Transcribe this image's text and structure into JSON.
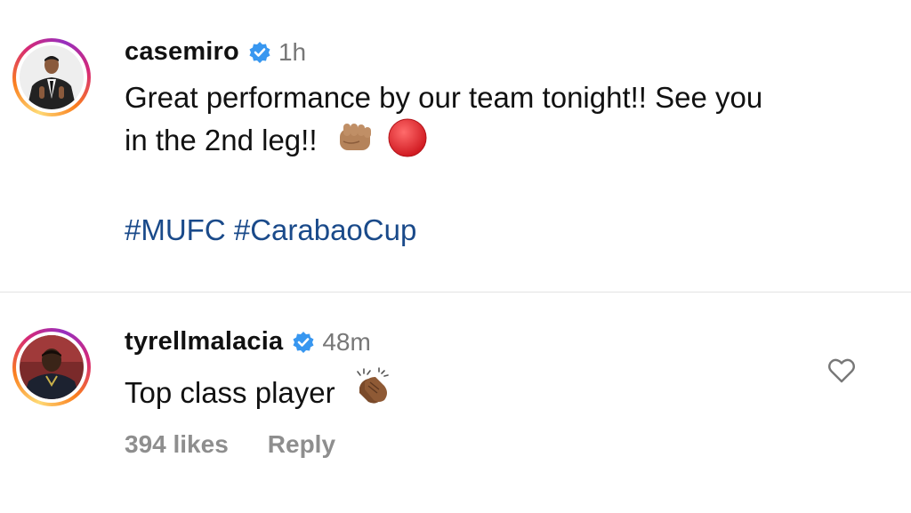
{
  "post": {
    "username": "casemiro",
    "time": "1h",
    "caption_line1": "Great performance by our team tonight!! See you",
    "caption_line2": "in the 2nd leg!!",
    "hashtags": [
      "#MUFC",
      "#CarabaoCup"
    ]
  },
  "comment": {
    "username": "tyrellmalacia",
    "time": "48m",
    "text": "Top class player",
    "likes": "394 likes",
    "reply_label": "Reply"
  },
  "icons": {
    "verified": "verified-badge-icon",
    "fist": "oncoming-fist-emoji",
    "red_circle": "red-circle-emoji",
    "clap": "clapping-hands-emoji",
    "like": "heart-outline-icon"
  },
  "colors": {
    "verified_blue": "#3897f0",
    "hashtag": "#1a4a8a",
    "muted": "#8e8e8e",
    "red_circle": "#e0242b"
  }
}
